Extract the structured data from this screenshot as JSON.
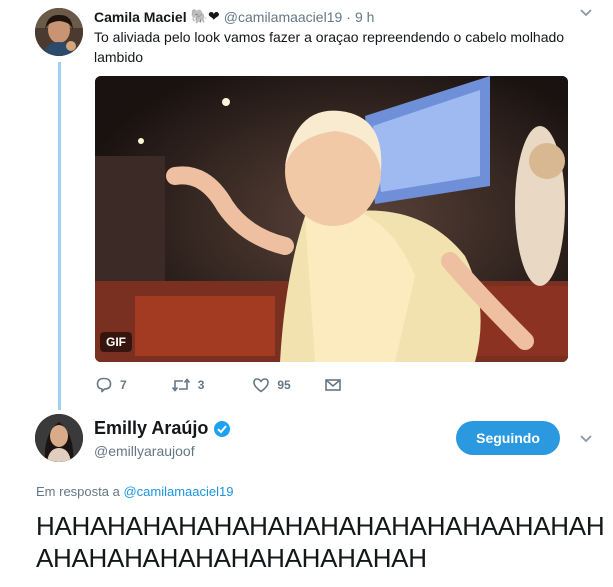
{
  "tweet1": {
    "author_name": "Camila Maciel",
    "emoji": "🐘❤",
    "handle": "@camilamaaciel19",
    "separator": "·",
    "time": "9 h",
    "text": "To aliviada pelo look vamos fazer a oraçao repreendendo o cabelo molhado lambido",
    "media_badge": "GIF",
    "actions": {
      "replies": "7",
      "retweets": "3",
      "likes": "95"
    }
  },
  "tweet2": {
    "author_name": "Emilly Araújo",
    "handle": "@emillyaraujoof",
    "follow_label": "Seguindo",
    "reply_prefix": "Em resposta a",
    "reply_handle": "@camilamaaciel19",
    "text": "HAHAHAHAHAHAHAHAHAHAHAHAHAAHAHAHAHAHAHAHAHAHAHAHAHAHAH"
  },
  "colors": {
    "accent": "#1b95e0",
    "follow_button": "#2b99e0",
    "verified": "#1da1f2",
    "thread_line": "#a0d1f0",
    "muted": "#657786"
  }
}
